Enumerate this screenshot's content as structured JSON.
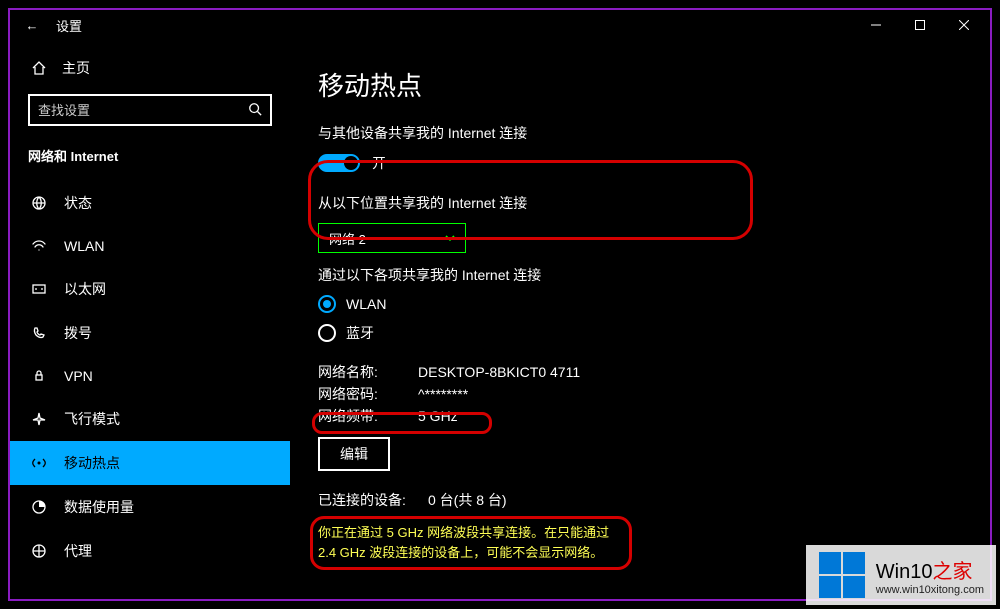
{
  "titlebar": {
    "title": "设置"
  },
  "sidebar": {
    "home": "主页",
    "search_placeholder": "查找设置",
    "category": "网络和 Internet",
    "items": [
      {
        "label": "状态"
      },
      {
        "label": "WLAN"
      },
      {
        "label": "以太网"
      },
      {
        "label": "拨号"
      },
      {
        "label": "VPN"
      },
      {
        "label": "飞行模式"
      },
      {
        "label": "移动热点"
      },
      {
        "label": "数据使用量"
      },
      {
        "label": "代理"
      }
    ]
  },
  "main": {
    "heading": "移动热点",
    "share_label": "与其他设备共享我的 Internet 连接",
    "toggle_state": "开",
    "share_from_label": "从以下位置共享我的 Internet 连接",
    "share_from_value": "网络 2",
    "share_over_label": "通过以下各项共享我的 Internet 连接",
    "radio_options": [
      {
        "label": "WLAN",
        "selected": true
      },
      {
        "label": "蓝牙",
        "selected": false
      }
    ],
    "net_name_key": "网络名称:",
    "net_name_val": "DESKTOP-8BKICT0 4711",
    "net_pwd_key": "网络密码:",
    "net_pwd_val": "^********",
    "net_band_key": "网络频带:",
    "net_band_val": "5 GHz",
    "edit_label": "编辑",
    "connected_key": "已连接的设备:",
    "connected_val": "0 台(共 8 台)",
    "warning_text": "你正在通过 5 GHz 网络波段共享连接。在只能通过 2.4 GHz 波段连接的设备上，可能不会显示网络。"
  },
  "watermark": {
    "brand_a": "Win10",
    "brand_b": "之家",
    "url": "www.win10xitong.com"
  }
}
